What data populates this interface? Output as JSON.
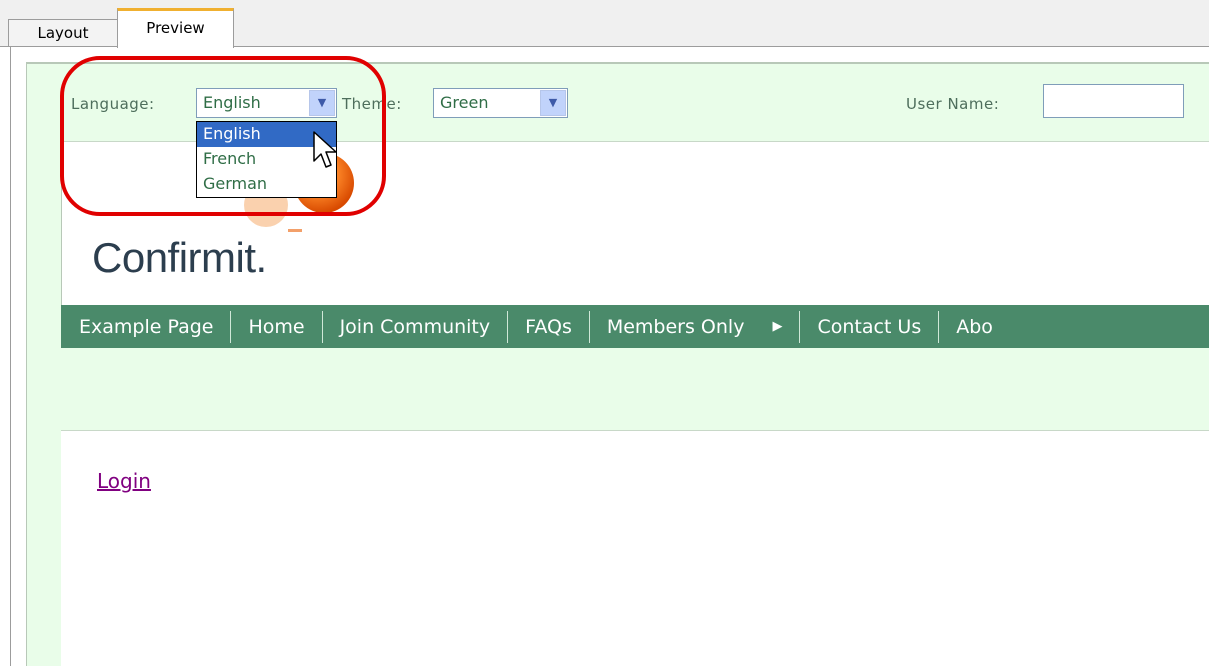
{
  "tabs": {
    "layout": "Layout",
    "preview": "Preview"
  },
  "header": {
    "language_label": "Language:",
    "language_value": "English",
    "theme_label": "Theme:",
    "theme_value": "Green",
    "username_label": "User Name:",
    "username_value": ""
  },
  "language_options": [
    "English",
    "French",
    "German"
  ],
  "brand": "Confirmit.",
  "nav": {
    "items": [
      "Example Page",
      "Home",
      "Join Community",
      "FAQs",
      "Members Only",
      "Contact Us",
      "Abo"
    ]
  },
  "login_link": "Login",
  "colors": {
    "nav_bg": "#4a8a6a",
    "header_bg": "#e9fde9",
    "highlight": "#e00000",
    "link": "#800080"
  }
}
